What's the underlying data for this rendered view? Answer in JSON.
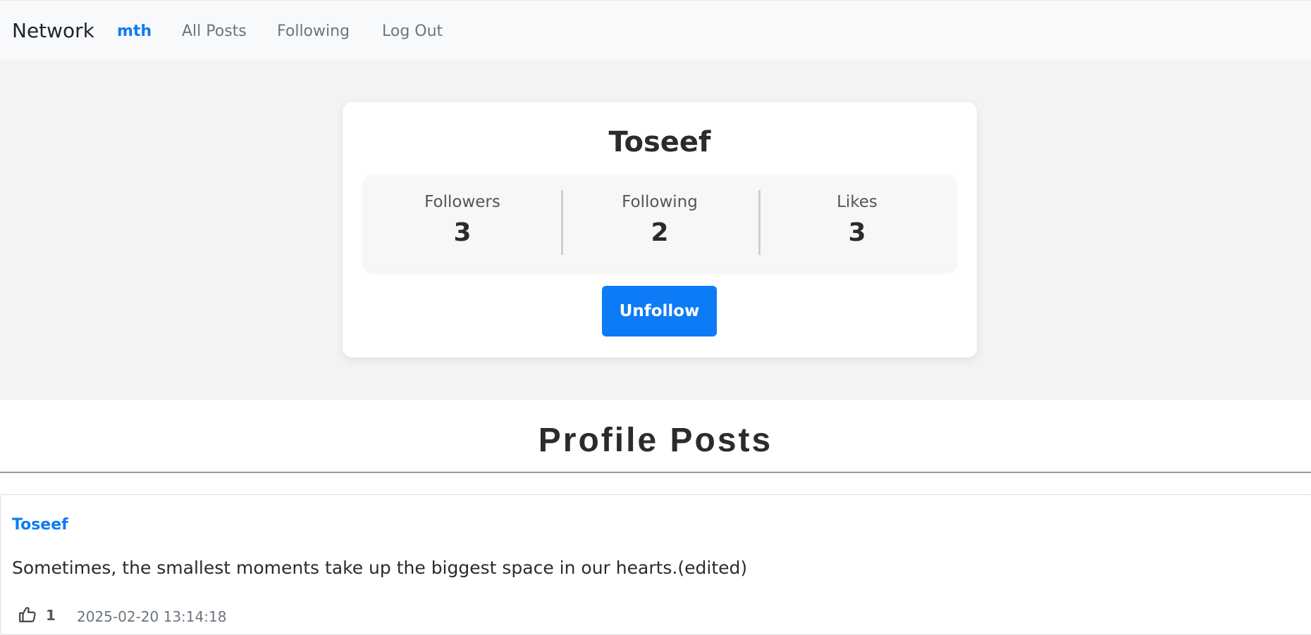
{
  "navbar": {
    "brand": "Network",
    "user": "mth",
    "all_posts": "All Posts",
    "following": "Following",
    "log_out": "Log Out"
  },
  "profile": {
    "name": "Toseef",
    "stats": {
      "followers_label": "Followers",
      "followers_value": "3",
      "following_label": "Following",
      "following_value": "2",
      "likes_label": "Likes",
      "likes_value": "3"
    },
    "action_label": "Unfollow"
  },
  "section": {
    "title": "Profile Posts"
  },
  "posts": [
    {
      "author": "Toseef",
      "body": "Sometimes, the smallest moments take up the biggest space in our hearts.(edited)",
      "likes": "1",
      "timestamp": "2025-02-20 13:14:18",
      "like_icon": "thumbs-up-icon"
    }
  ],
  "colors": {
    "accent": "#0d7bf5",
    "navbar_bg": "#f8f9fa",
    "band_bg": "#f3f3f3"
  }
}
